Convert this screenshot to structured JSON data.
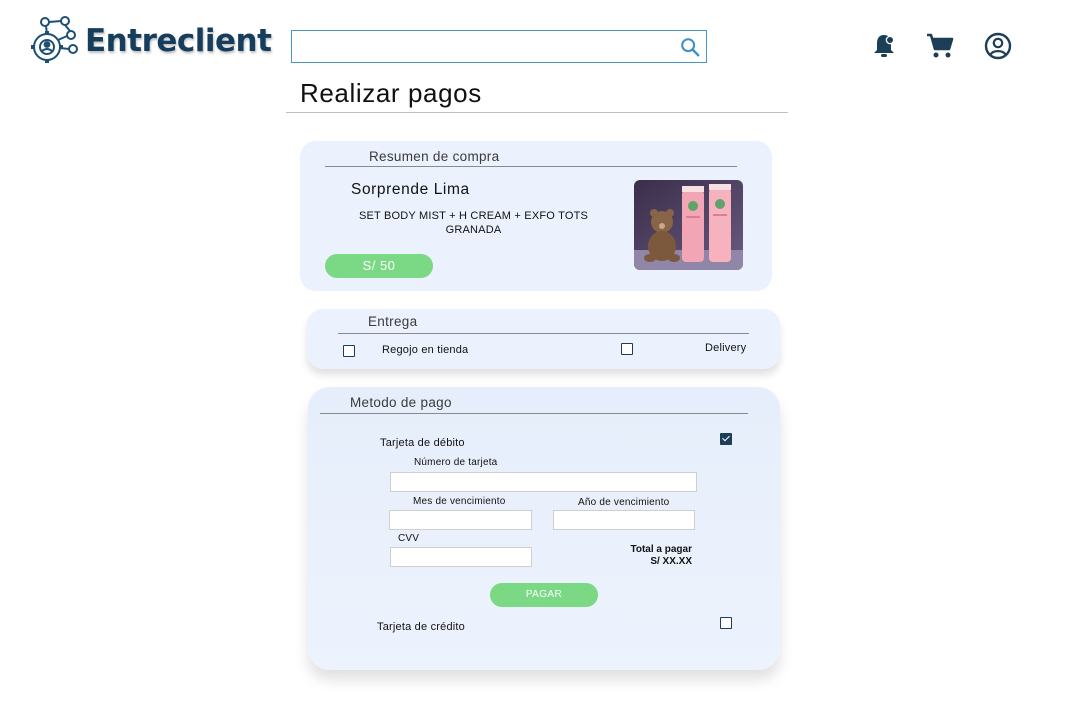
{
  "header": {
    "brand": "Entreclient",
    "search": {
      "value": "",
      "placeholder": ""
    },
    "icons": [
      "bell-icon",
      "cart-icon",
      "account-icon"
    ]
  },
  "page_title": "Realizar pagos",
  "summary": {
    "heading": "Resumen de compra",
    "store": "Sorprende Lima",
    "product": "SET BODY MIST + H CREAM + EXFO TOTS GRANADA",
    "price": "S/ 50"
  },
  "delivery": {
    "heading": "Entrega",
    "options": [
      {
        "label": "Regojo en tienda",
        "checked": false
      },
      {
        "label": "Delivery",
        "checked": false
      }
    ]
  },
  "payment": {
    "heading": "Metodo de pago",
    "debit": {
      "label": "Tarjeta de débito",
      "checked": true
    },
    "card_number_label": "Número de tarjeta",
    "month_label": "Mes de vencimiento",
    "year_label": "Año de vencimiento",
    "cvv_label": "CVV",
    "total_label": "Total a pagar",
    "total_value": "S/ XX.XX",
    "pay_button": "PAGAR",
    "credit": {
      "label": "Tarjeta de crédito",
      "checked": false
    }
  },
  "colors": {
    "brand": "#163e5c",
    "accent_green": "#7bd985",
    "card_bg": "#ebf2fd",
    "search_border": "#4a94c8"
  }
}
